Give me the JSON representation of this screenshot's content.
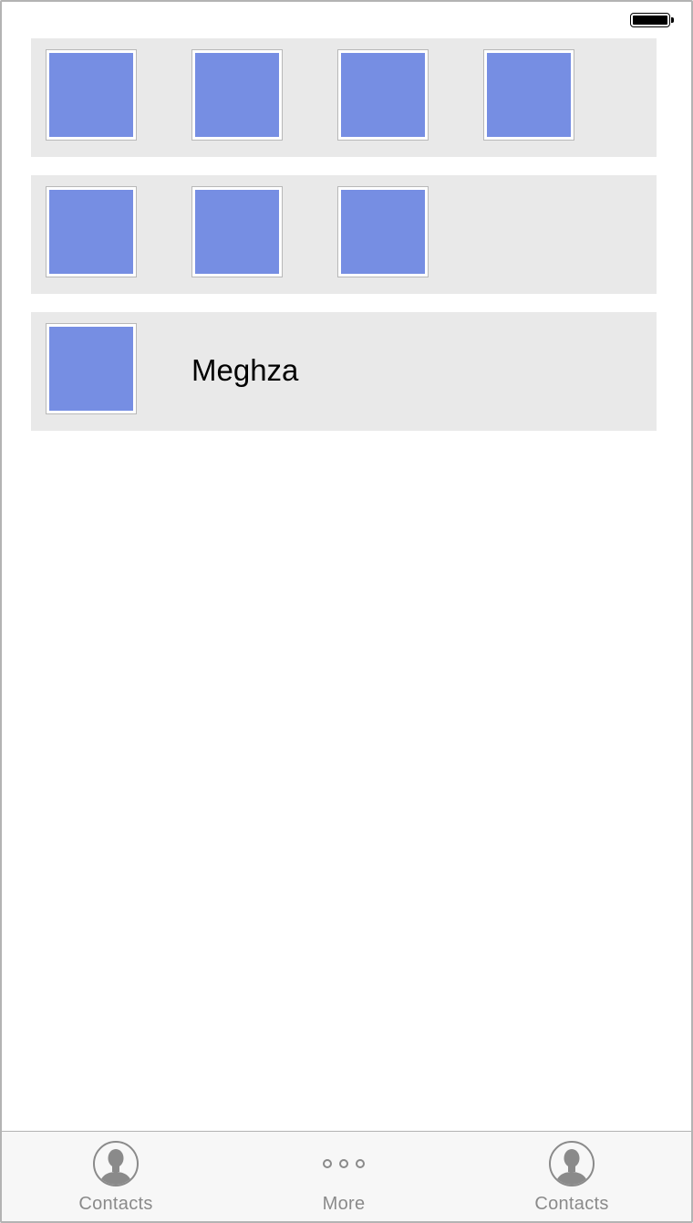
{
  "status_bar": {
    "battery_level": 1.0
  },
  "rows": [
    {
      "tiles": 4,
      "label": ""
    },
    {
      "tiles": 3,
      "label": ""
    },
    {
      "tiles": 1,
      "label": "Meghza"
    }
  ],
  "tab_bar": {
    "tabs": [
      {
        "label": "Contacts",
        "icon": "person-silhouette-icon"
      },
      {
        "label": "More",
        "icon": "more-dots-icon"
      },
      {
        "label": "Contacts",
        "icon": "person-silhouette-icon"
      }
    ]
  },
  "colors": {
    "tile_fill": "#768ee3",
    "row_background": "#e9e9e9",
    "tab_label": "#8a8a8a"
  }
}
